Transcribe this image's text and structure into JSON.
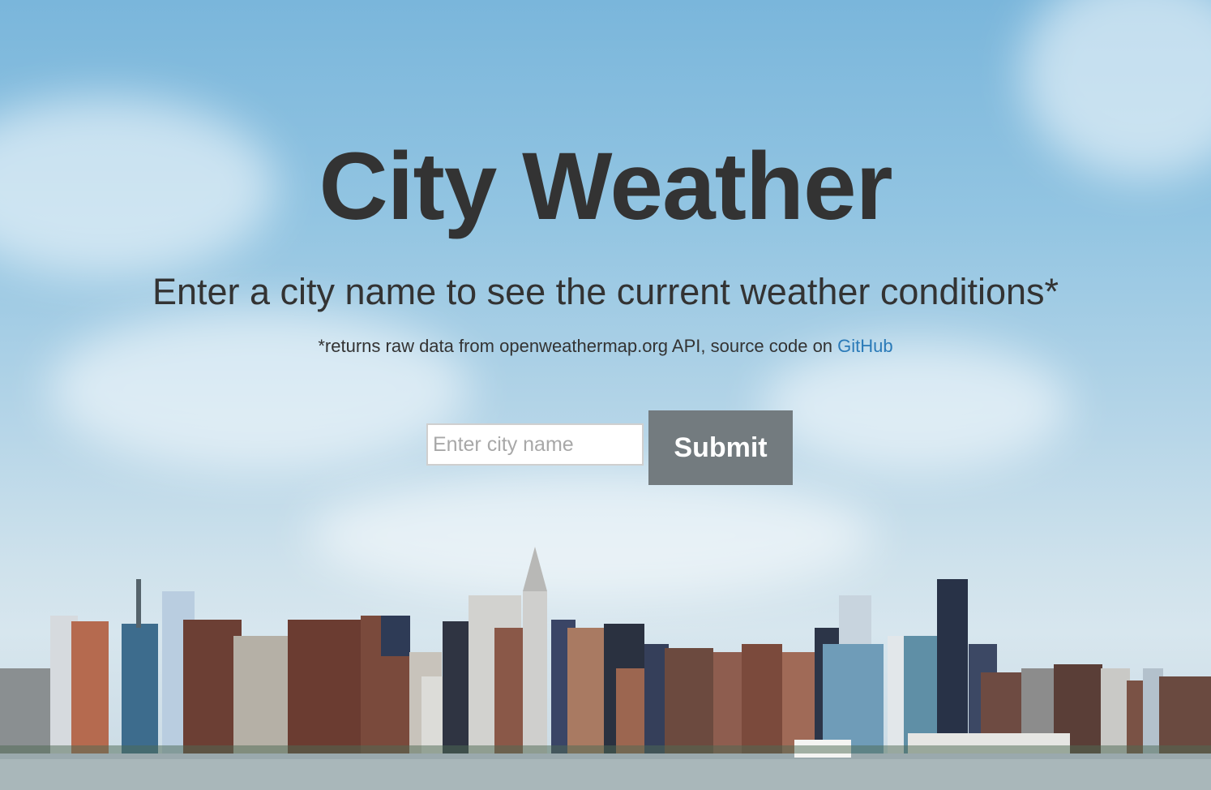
{
  "page": {
    "title": "City Weather",
    "subtitle": "Enter a city name to see the current weather conditions*",
    "note_prefix": "*returns raw data from openweathermap.org API, source code on ",
    "note_link": "GitHub"
  },
  "form": {
    "city_placeholder": "Enter city name",
    "city_value": "",
    "submit_label": "Submit"
  },
  "colors": {
    "text": "#333333",
    "link": "#2a7ab8",
    "button_bg": "#737b7f",
    "sky_top": "#7ab6db"
  },
  "background": {
    "icon": "city-skyline-photo"
  }
}
